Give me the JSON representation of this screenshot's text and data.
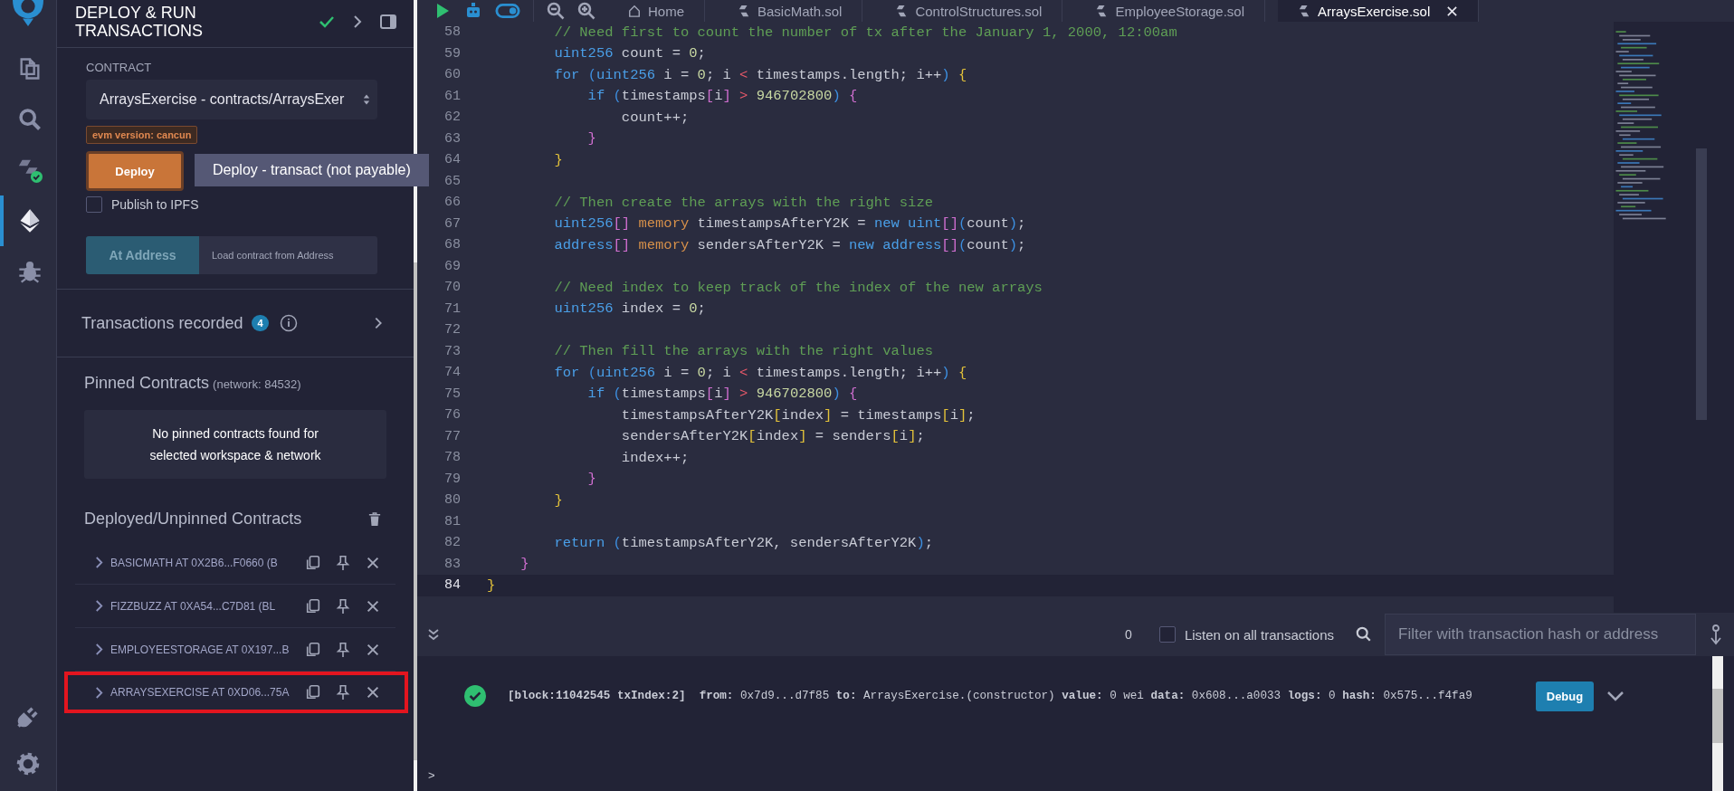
{
  "icon_bar": [
    {
      "selected": false
    },
    {
      "selected": false
    },
    {
      "selected": false,
      "check": true
    },
    {
      "selected": true
    },
    {
      "selected": false
    }
  ],
  "side_panel": {
    "title": "DEPLOY & RUN TRANSACTIONS",
    "compiled": true,
    "contract_label": "CONTRACT",
    "contract_value": "ArraysExercise - contracts/ArraysExer",
    "evm_badge": "evm version: cancun",
    "deploy_button": "Deploy",
    "tooltip": "Deploy - transact (not payable)",
    "publish": {
      "label": "Publish to IPFS",
      "checked": false
    },
    "at_address_button": "At Address",
    "address_placeholder": "Load contract from Address",
    "transactions": {
      "label": "Transactions recorded",
      "count": "4"
    },
    "pinned": {
      "title": "Pinned Contracts",
      "network": "(network: 84532)",
      "empty": "No pinned contracts found for selected workspace & network"
    },
    "deployed": {
      "title": "Deployed/Unpinned Contracts",
      "items": [
        {
          "label": "BASICMATH AT 0X2B6...F0660 (B",
          "highlighted": false
        },
        {
          "label": "FIZZBUZZ AT 0XA54...C7D81 (BL",
          "highlighted": false
        },
        {
          "label": "EMPLOYEESTORAGE AT 0X197...B",
          "highlighted": false
        },
        {
          "label": "ARRAYSEXERCISE AT 0XD06...75A",
          "highlighted": true
        }
      ]
    }
  },
  "editor_tabs": [
    {
      "label": "Home",
      "kind": "home",
      "selected": false
    },
    {
      "label": "BasicMath.sol",
      "kind": "file",
      "selected": false
    },
    {
      "label": "ControlStructures.sol",
      "kind": "file",
      "selected": false
    },
    {
      "label": "EmployeeStorage.sol",
      "kind": "file",
      "selected": false
    },
    {
      "label": "ArraysExercise.sol",
      "kind": "file",
      "selected": true
    }
  ],
  "code_lines": [
    {
      "number": "58",
      "current": false,
      "tokens": [
        {
          "text": "        // Need first to count the number of tx after the January 1, 2000, 12:00am",
          "kind": "comment"
        }
      ]
    },
    {
      "number": "59",
      "current": false,
      "tokens": [
        {
          "text": "        uint256",
          "kind": "keyword"
        },
        {
          "text": " count = ",
          "kind": "plain"
        },
        {
          "text": "0",
          "kind": "number"
        },
        {
          "text": ";",
          "kind": "plain"
        }
      ]
    },
    {
      "number": "60",
      "current": false,
      "tokens": [
        {
          "text": "        for",
          "kind": "keyword"
        },
        {
          "text": " (",
          "kind": "paren"
        },
        {
          "text": "uint256",
          "kind": "keyword"
        },
        {
          "text": " i = ",
          "kind": "plain"
        },
        {
          "text": "0",
          "kind": "number"
        },
        {
          "text": "; i ",
          "kind": "plain"
        },
        {
          "text": "<",
          "kind": "operator"
        },
        {
          "text": " timestamps.length; i++",
          "kind": "plain"
        },
        {
          "text": ")",
          "kind": "paren"
        },
        {
          "text": " {",
          "kind": "brace"
        }
      ]
    },
    {
      "number": "61",
      "current": false,
      "tokens": [
        {
          "text": "            if",
          "kind": "keyword"
        },
        {
          "text": " (",
          "kind": "paren"
        },
        {
          "text": "timestamps",
          "kind": "plain"
        },
        {
          "text": "[",
          "kind": "bracket"
        },
        {
          "text": "i",
          "kind": "plain"
        },
        {
          "text": "]",
          "kind": "bracket"
        },
        {
          "text": " >",
          "kind": "operator"
        },
        {
          "text": " 946702800",
          "kind": "number"
        },
        {
          "text": ")",
          "kind": "paren"
        },
        {
          "text": " {",
          "kind": "bracket"
        }
      ]
    },
    {
      "number": "62",
      "current": false,
      "tokens": [
        {
          "text": "                count++;",
          "kind": "plain"
        }
      ]
    },
    {
      "number": "63",
      "current": false,
      "tokens": [
        {
          "text": "            }",
          "kind": "bracket"
        }
      ]
    },
    {
      "number": "64",
      "current": false,
      "tokens": [
        {
          "text": "        }",
          "kind": "brace"
        }
      ]
    },
    {
      "number": "65",
      "current": false
    },
    {
      "number": "66",
      "current": false,
      "tokens": [
        {
          "text": "        // Then create the arrays with the right size",
          "kind": "comment"
        }
      ]
    },
    {
      "number": "67",
      "current": false,
      "tokens": [
        {
          "text": "        uint256",
          "kind": "keyword"
        },
        {
          "text": "[]",
          "kind": "bracket"
        },
        {
          "text": " memory",
          "kind": "storage"
        },
        {
          "text": " timestampsAfterY2K = ",
          "kind": "plain"
        },
        {
          "text": "new",
          "kind": "keyword"
        },
        {
          "text": " uint",
          "kind": "keyword"
        },
        {
          "text": "[]",
          "kind": "bracket"
        },
        {
          "text": "(",
          "kind": "paren"
        },
        {
          "text": "count",
          "kind": "plain"
        },
        {
          "text": ")",
          "kind": "paren"
        },
        {
          "text": ";",
          "kind": "plain"
        }
      ]
    },
    {
      "number": "68",
      "current": false,
      "tokens": [
        {
          "text": "        address",
          "kind": "keyword"
        },
        {
          "text": "[]",
          "kind": "bracket"
        },
        {
          "text": " memory",
          "kind": "storage"
        },
        {
          "text": " sendersAfterY2K = ",
          "kind": "plain"
        },
        {
          "text": "new",
          "kind": "keyword"
        },
        {
          "text": " address",
          "kind": "keyword"
        },
        {
          "text": "[]",
          "kind": "bracket"
        },
        {
          "text": "(",
          "kind": "paren"
        },
        {
          "text": "count",
          "kind": "plain"
        },
        {
          "text": ")",
          "kind": "paren"
        },
        {
          "text": ";",
          "kind": "plain"
        }
      ]
    },
    {
      "number": "69",
      "current": false
    },
    {
      "number": "70",
      "current": false,
      "tokens": [
        {
          "text": "        // Need index to keep track of the index of the new arrays",
          "kind": "comment"
        }
      ]
    },
    {
      "number": "71",
      "current": false,
      "tokens": [
        {
          "text": "        uint256",
          "kind": "keyword"
        },
        {
          "text": " index = ",
          "kind": "plain"
        },
        {
          "text": "0",
          "kind": "number"
        },
        {
          "text": ";",
          "kind": "plain"
        }
      ]
    },
    {
      "number": "72",
      "current": false
    },
    {
      "number": "73",
      "current": false,
      "tokens": [
        {
          "text": "        // Then fill the arrays with the right values",
          "kind": "comment"
        }
      ]
    },
    {
      "number": "74",
      "current": false,
      "tokens": [
        {
          "text": "        for",
          "kind": "keyword"
        },
        {
          "text": " (",
          "kind": "paren"
        },
        {
          "text": "uint256",
          "kind": "keyword"
        },
        {
          "text": " i = ",
          "kind": "plain"
        },
        {
          "text": "0",
          "kind": "number"
        },
        {
          "text": "; i ",
          "kind": "plain"
        },
        {
          "text": "<",
          "kind": "operator"
        },
        {
          "text": " timestamps.length; i++",
          "kind": "plain"
        },
        {
          "text": ")",
          "kind": "paren"
        },
        {
          "text": " {",
          "kind": "brace"
        }
      ]
    },
    {
      "number": "75",
      "current": false,
      "tokens": [
        {
          "text": "            if",
          "kind": "keyword"
        },
        {
          "text": " (",
          "kind": "paren"
        },
        {
          "text": "timestamps",
          "kind": "plain"
        },
        {
          "text": "[",
          "kind": "bracket"
        },
        {
          "text": "i",
          "kind": "plain"
        },
        {
          "text": "]",
          "kind": "bracket"
        },
        {
          "text": " >",
          "kind": "operator"
        },
        {
          "text": " 946702800",
          "kind": "number"
        },
        {
          "text": ")",
          "kind": "paren"
        },
        {
          "text": " {",
          "kind": "bracket"
        }
      ]
    },
    {
      "number": "76",
      "current": false,
      "tokens": [
        {
          "text": "                timestampsAfterY2K",
          "kind": "plain"
        },
        {
          "text": "[",
          "kind": "brace"
        },
        {
          "text": "index",
          "kind": "plain"
        },
        {
          "text": "]",
          "kind": "brace"
        },
        {
          "text": " = timestamps",
          "kind": "plain"
        },
        {
          "text": "[",
          "kind": "brace"
        },
        {
          "text": "i",
          "kind": "plain"
        },
        {
          "text": "]",
          "kind": "brace"
        },
        {
          "text": ";",
          "kind": "plain"
        }
      ]
    },
    {
      "number": "77",
      "current": false,
      "tokens": [
        {
          "text": "                sendersAfterY2K",
          "kind": "plain"
        },
        {
          "text": "[",
          "kind": "brace"
        },
        {
          "text": "index",
          "kind": "plain"
        },
        {
          "text": "]",
          "kind": "brace"
        },
        {
          "text": " = senders",
          "kind": "plain"
        },
        {
          "text": "[",
          "kind": "brace"
        },
        {
          "text": "i",
          "kind": "plain"
        },
        {
          "text": "]",
          "kind": "brace"
        },
        {
          "text": ";",
          "kind": "plain"
        }
      ]
    },
    {
      "number": "78",
      "current": false,
      "tokens": [
        {
          "text": "                index++;",
          "kind": "plain"
        }
      ]
    },
    {
      "number": "79",
      "current": false,
      "tokens": [
        {
          "text": "            }",
          "kind": "bracket"
        }
      ]
    },
    {
      "number": "80",
      "current": false,
      "tokens": [
        {
          "text": "        }",
          "kind": "brace"
        }
      ]
    },
    {
      "number": "81",
      "current": false
    },
    {
      "number": "82",
      "current": false,
      "tokens": [
        {
          "text": "        return",
          "kind": "keyword"
        },
        {
          "text": " (",
          "kind": "paren"
        },
        {
          "text": "timestampsAfterY2K, sendersAfterY2K",
          "kind": "plain"
        },
        {
          "text": ")",
          "kind": "paren"
        },
        {
          "text": ";",
          "kind": "plain"
        }
      ]
    },
    {
      "number": "83",
      "current": false,
      "tokens": [
        {
          "text": "    }",
          "kind": "bracket"
        }
      ]
    },
    {
      "number": "84",
      "current": true,
      "tokens": [
        {
          "text": "}",
          "kind": "brace"
        }
      ]
    }
  ],
  "terminal": {
    "count": "0",
    "listen": {
      "label": "Listen on all transactions",
      "checked": false
    },
    "filter_placeholder": "Filter with transaction hash or address",
    "log": {
      "success": true,
      "text": "**[block:11042545 txIndex:2]**  **from:** 0x7d9...d7f85 **to:** ArraysExercise.(constructor) **value:** 0 wei **data:** 0x608...a0033 **logs:** 0 **hash:** 0x575...f4fa9",
      "debug_button": "Debug"
    },
    "prompt": ">"
  }
}
